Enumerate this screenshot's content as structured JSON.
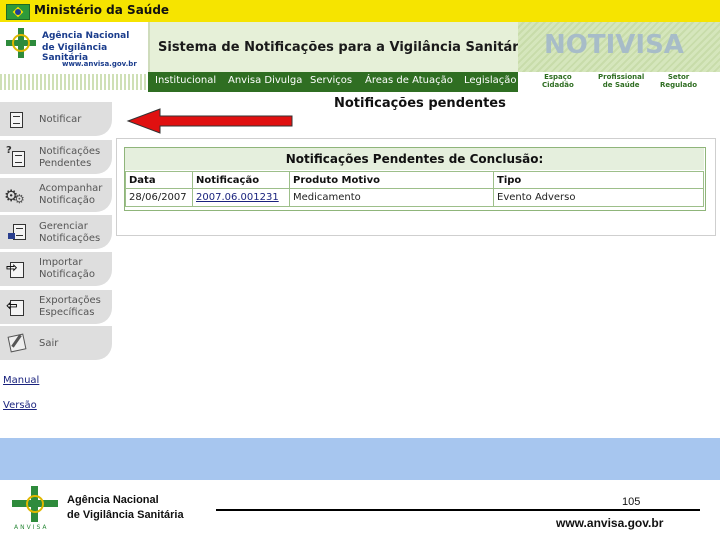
{
  "ministry": {
    "label": "Ministério da Saúde"
  },
  "agency": {
    "line1": "Agência Nacional",
    "line2": "de Vigilância Sanitária",
    "url": "www.anvisa.gov.br"
  },
  "header": {
    "system_title": "Sistema de Notificações para a Vigilância Sanitária",
    "brand": "NOTIVISA"
  },
  "nav": {
    "items": [
      "Institucional",
      "Anvisa Divulga",
      "Serviços",
      "Áreas de Atuação",
      "Legislação"
    ],
    "right_links": [
      {
        "line1": "Espaço",
        "line2": "Cidadão"
      },
      {
        "line1": "Profissional",
        "line2": "de Saúde"
      },
      {
        "line1": "Setor",
        "line2": "Regulado"
      }
    ]
  },
  "sidebar": {
    "items": [
      {
        "label_line1": "Notificar",
        "label_line2": "",
        "icon": "document-icon"
      },
      {
        "label_line1": "Notificações",
        "label_line2": "Pendentes",
        "icon": "pending-question-icon"
      },
      {
        "label_line1": "Acompanhar",
        "label_line2": "Notificação",
        "icon": "gears-icon"
      },
      {
        "label_line1": "Gerenciar",
        "label_line2": "Notificações",
        "icon": "manage-docs-icon"
      },
      {
        "label_line1": "Importar",
        "label_line2": "Notificação",
        "icon": "import-arrow-icon"
      },
      {
        "label_line1": "Exportações",
        "label_line2": "Específicas",
        "icon": "export-arrow-icon"
      },
      {
        "label_line1": "Sair",
        "label_line2": "",
        "icon": "exit-notepad-icon"
      }
    ],
    "links": {
      "manual": "Manual",
      "versao": "Versão"
    }
  },
  "main": {
    "heading": "Notificações pendentes",
    "panel_title": "Notificações Pendentes de Conclusão:",
    "table": {
      "columns": [
        "Data",
        "Notificação",
        "Produto Motivo",
        "Tipo"
      ],
      "rows": [
        {
          "data": "28/06/2007",
          "notificacao": "2007.06.001231",
          "produto": "Medicamento",
          "tipo": "Evento Adverso"
        }
      ]
    }
  },
  "footer": {
    "logo_text": "ANVISA",
    "agency_line1": "Agência Nacional",
    "agency_line2": "de Vigilância Sanitária",
    "page_number": "105",
    "url": "www.anvisa.gov.br"
  },
  "colors": {
    "ministry_bar": "#f6e400",
    "nav_green": "#2f6e22",
    "panel_title_bg": "#e5efdd",
    "footer_blue": "#a7c6ef",
    "arrow_red": "#e01010"
  }
}
